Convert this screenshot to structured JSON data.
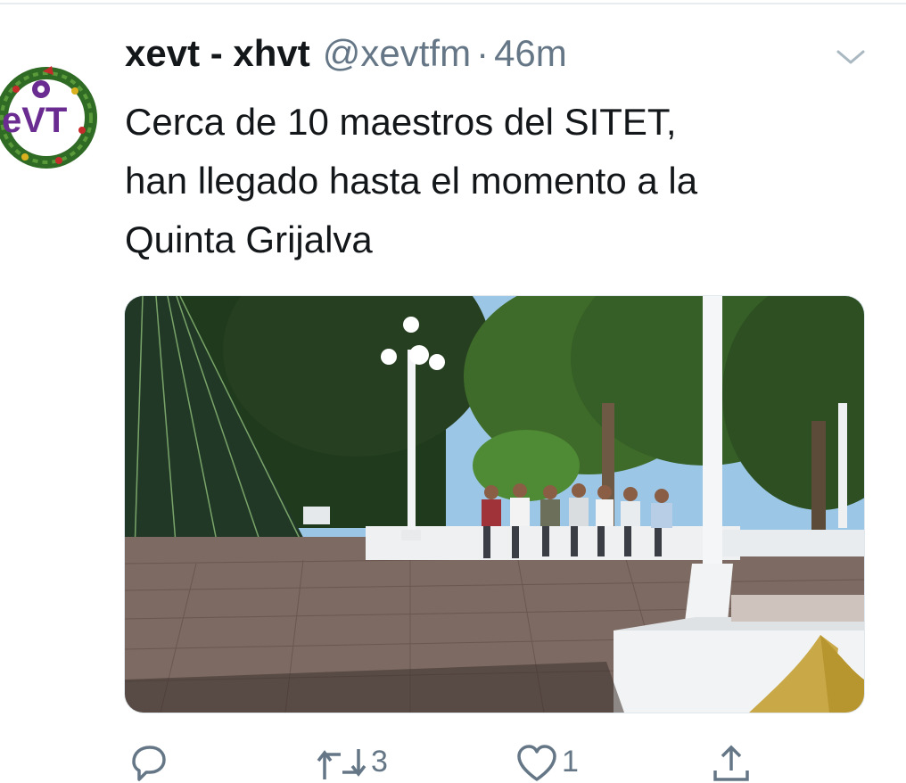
{
  "tweet": {
    "display_name": "xevt - xhvt",
    "handle": "@xevtfm",
    "separator": "·",
    "timestamp": "46m",
    "text": "Cerca de 10 maestros del SITET,\nhan llegado hasta el momento a la\nQuinta Grijalva",
    "avatar": {
      "logo_text": "eVT"
    }
  },
  "actions": {
    "reply": {
      "icon": "reply-icon",
      "count": ""
    },
    "retweet": {
      "icon": "retweet-icon",
      "count": "3"
    },
    "like": {
      "icon": "heart-icon",
      "count": "1"
    },
    "share": {
      "icon": "share-icon",
      "count": ""
    }
  },
  "colors": {
    "text": "#14171a",
    "secondary": "#657786",
    "divider": "#e6ecf0",
    "logo_purple": "#6b2c91"
  }
}
